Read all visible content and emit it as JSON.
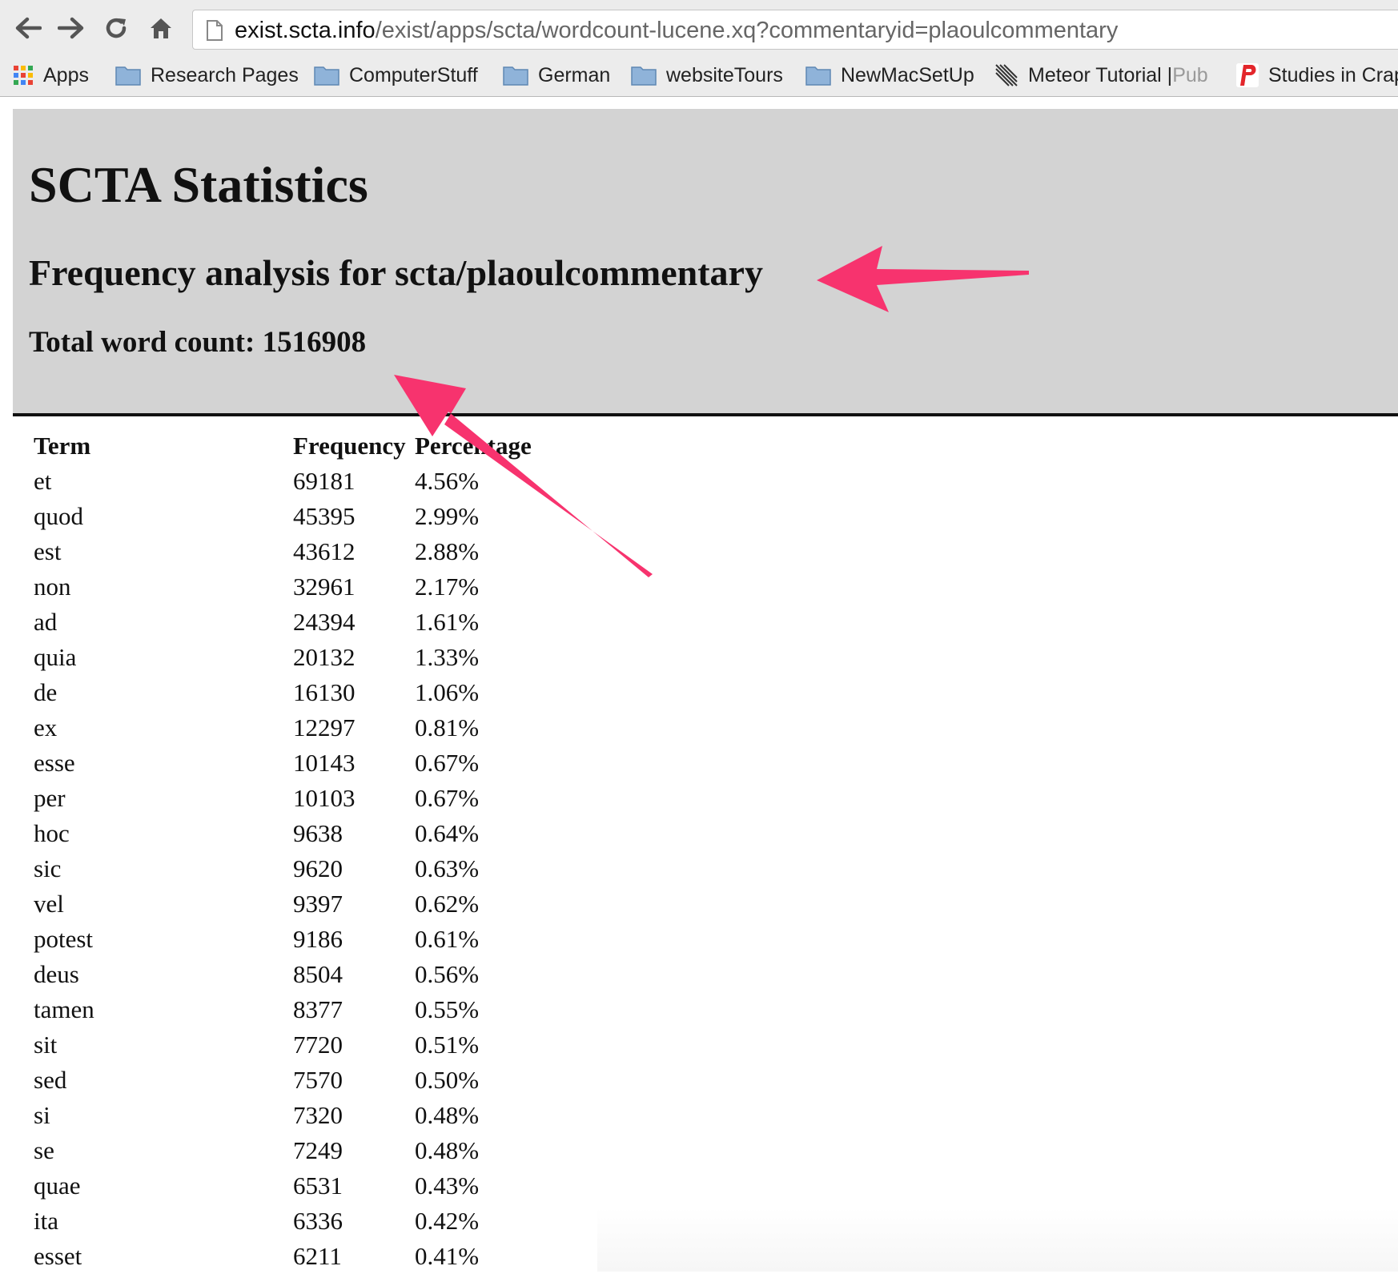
{
  "browser": {
    "url_host": "exist.scta.info",
    "url_path": "/exist/apps/scta/wordcount-lucene.xq?commentaryid=plaoulcommentary",
    "back_icon": "arrow-left-icon",
    "forward_icon": "arrow-right-icon",
    "reload_icon": "reload-icon",
    "home_icon": "home-icon",
    "page_icon": "document-icon"
  },
  "bookmarks": [
    {
      "label": "Apps",
      "icon": "apps-grid-icon"
    },
    {
      "label": "Research Pages",
      "icon": "folder-icon"
    },
    {
      "label": "ComputerStuff",
      "icon": "folder-icon"
    },
    {
      "label": "German",
      "icon": "folder-icon"
    },
    {
      "label": "websiteTours",
      "icon": "folder-icon"
    },
    {
      "label": "NewMacSetUp",
      "icon": "folder-icon"
    },
    {
      "label": "Meteor Tutorial | ",
      "faded": "Pub",
      "icon": "meteor-icon"
    },
    {
      "label": "Studies in Crap",
      "icon": "p-logo-icon"
    }
  ],
  "page": {
    "title": "SCTA Statistics",
    "subtitle": "Frequency analysis for scta/plaoulcommentary",
    "word_count_label": "Total word count: 1516908"
  },
  "table": {
    "headers": [
      "Term",
      "Frequency",
      "Percentage"
    ],
    "rows": [
      [
        "et",
        "69181",
        "4.56%"
      ],
      [
        "quod",
        "45395",
        "2.99%"
      ],
      [
        "est",
        "43612",
        "2.88%"
      ],
      [
        "non",
        "32961",
        "2.17%"
      ],
      [
        "ad",
        "24394",
        "1.61%"
      ],
      [
        "quia",
        "20132",
        "1.33%"
      ],
      [
        "de",
        "16130",
        "1.06%"
      ],
      [
        "ex",
        "12297",
        "0.81%"
      ],
      [
        "esse",
        "10143",
        "0.67%"
      ],
      [
        "per",
        "10103",
        "0.67%"
      ],
      [
        "hoc",
        "9638",
        "0.64%"
      ],
      [
        "sic",
        "9620",
        "0.63%"
      ],
      [
        "vel",
        "9397",
        "0.62%"
      ],
      [
        "potest",
        "9186",
        "0.61%"
      ],
      [
        "deus",
        "8504",
        "0.56%"
      ],
      [
        "tamen",
        "8377",
        "0.55%"
      ],
      [
        "sit",
        "7720",
        "0.51%"
      ],
      [
        "sed",
        "7570",
        "0.50%"
      ],
      [
        "si",
        "7320",
        "0.48%"
      ],
      [
        "se",
        "7249",
        "0.48%"
      ],
      [
        "quae",
        "6531",
        "0.43%"
      ],
      [
        "ita",
        "6336",
        "0.42%"
      ],
      [
        "esset",
        "6211",
        "0.41%"
      ]
    ]
  },
  "colors": {
    "header_band": "#d3d3d3",
    "annotation_arrow": "#f7336e",
    "folder_icon": "#8fb3d9"
  }
}
